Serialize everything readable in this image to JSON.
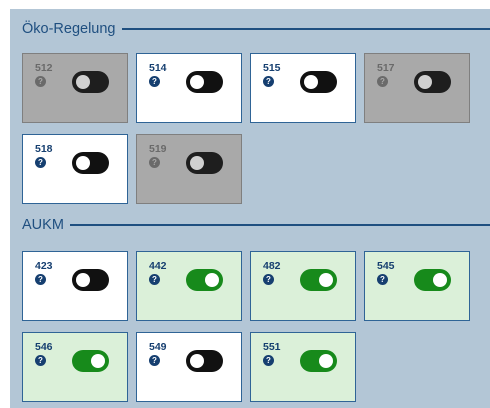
{
  "sections": [
    {
      "title": "Öko-Regelung",
      "tiles": [
        {
          "code": "512",
          "enabled": false,
          "on": false,
          "help": "?"
        },
        {
          "code": "514",
          "enabled": true,
          "on": false,
          "help": "?"
        },
        {
          "code": "515",
          "enabled": true,
          "on": false,
          "help": "?"
        },
        {
          "code": "517",
          "enabled": false,
          "on": false,
          "help": "?"
        },
        {
          "code": "518",
          "enabled": true,
          "on": false,
          "help": "?"
        },
        {
          "code": "519",
          "enabled": false,
          "on": false,
          "help": "?"
        }
      ]
    },
    {
      "title": "AUKM",
      "tiles": [
        {
          "code": "423",
          "enabled": true,
          "on": false,
          "help": "?"
        },
        {
          "code": "442",
          "enabled": true,
          "on": true,
          "help": "?"
        },
        {
          "code": "482",
          "enabled": true,
          "on": true,
          "help": "?"
        },
        {
          "code": "545",
          "enabled": true,
          "on": true,
          "help": "?"
        },
        {
          "code": "546",
          "enabled": true,
          "on": true,
          "help": "?"
        },
        {
          "code": "549",
          "enabled": true,
          "on": false,
          "help": "?"
        },
        {
          "code": "551",
          "enabled": true,
          "on": true,
          "help": "?"
        }
      ]
    }
  ],
  "colors": {
    "panel_background": "#b3c6d6",
    "accent": "#1f4f80",
    "toggle_on": "#178a1b",
    "toggle_off": "#111111",
    "tile_active_background": "#dbf0d9",
    "tile_disabled_background": "#a9a9a9"
  }
}
